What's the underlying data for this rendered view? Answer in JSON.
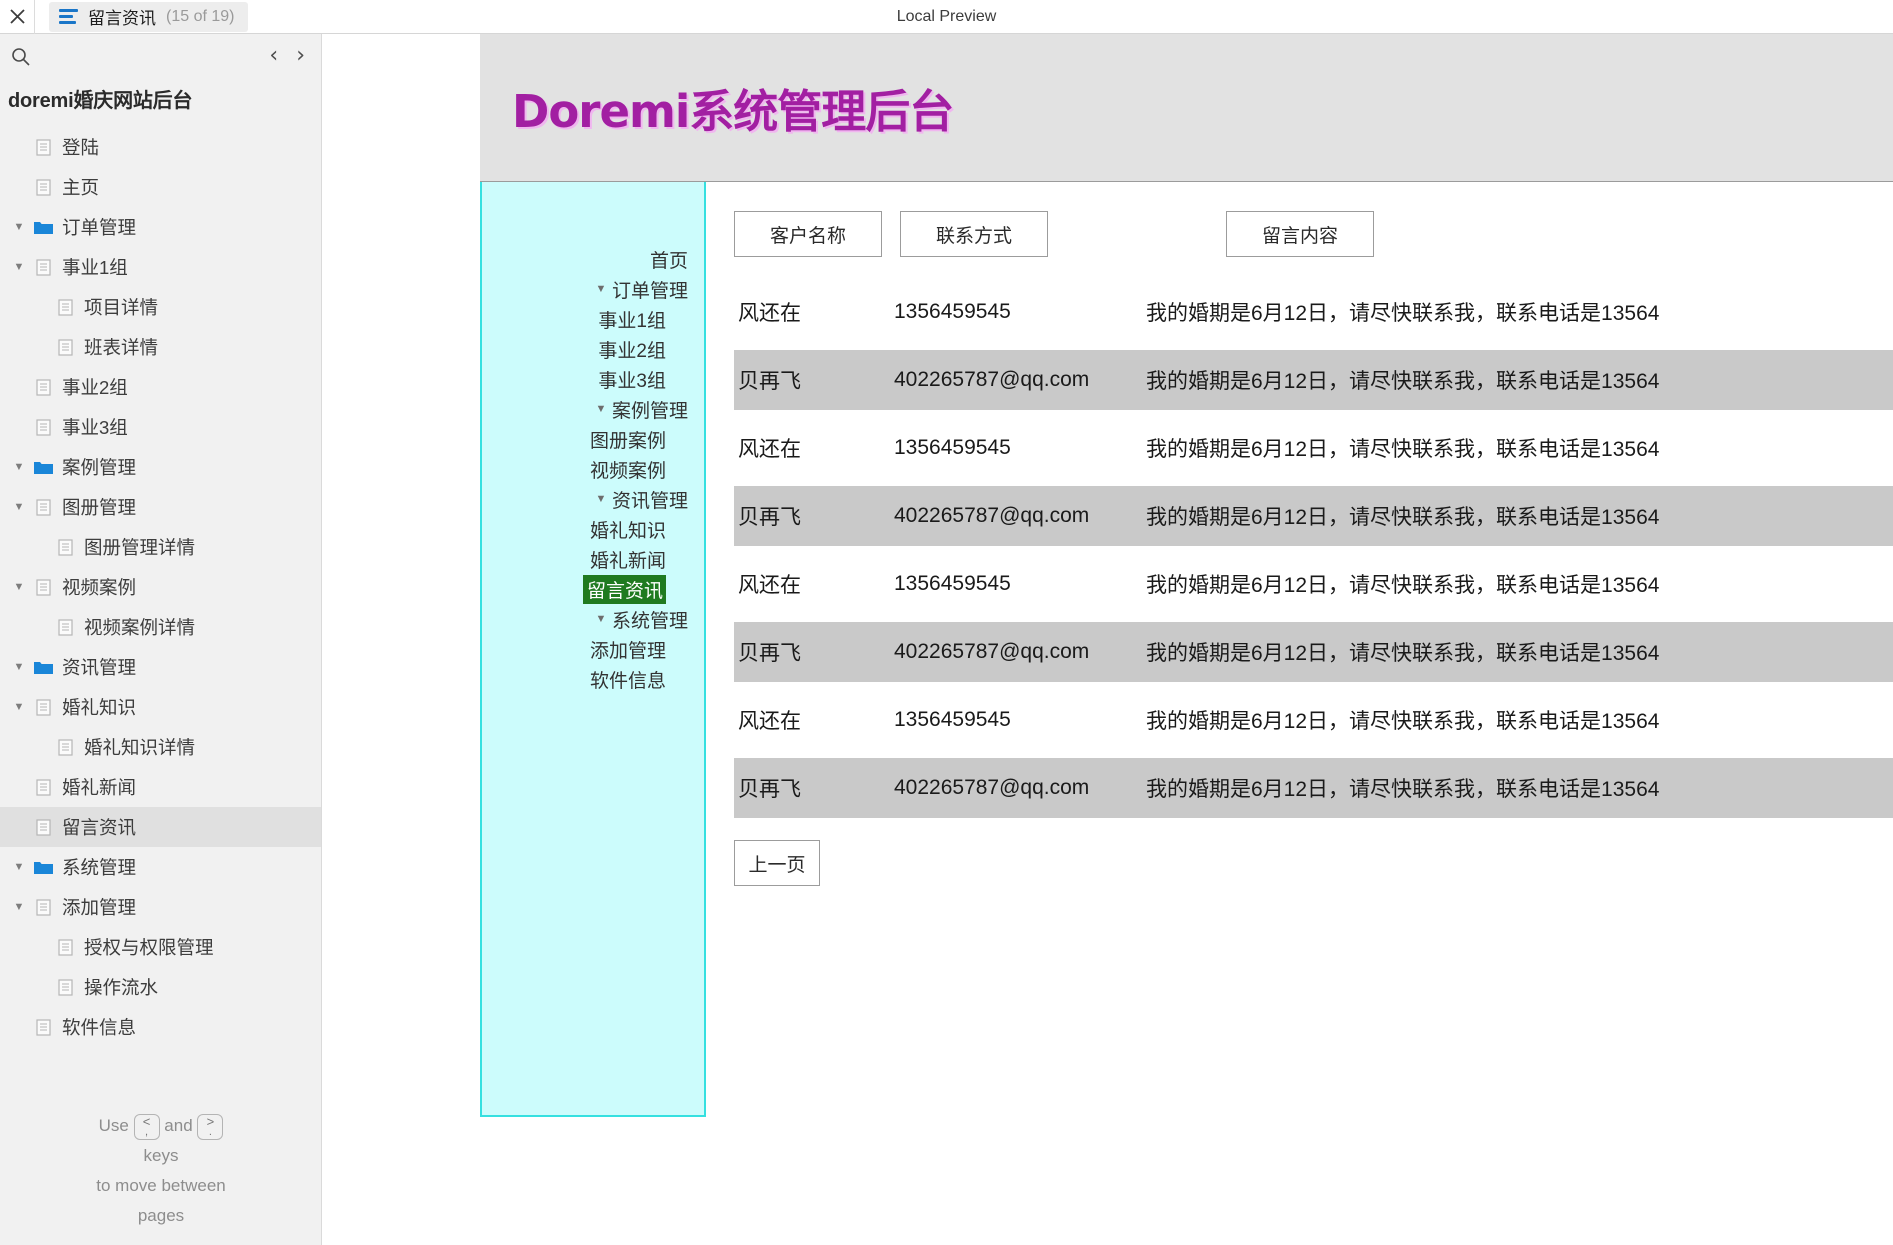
{
  "topbar": {
    "close_icon": "close-icon",
    "menu_icon": "hamburger-icon",
    "tab_title": "留言资讯",
    "tab_count": "(15 of 19)",
    "preview_label": "Local Preview"
  },
  "outline": {
    "search_icon": "search-icon",
    "prev_arrow": "‹",
    "next_arrow": "›",
    "title": "doremi婚庆网站后台",
    "items": [
      {
        "label": "登陆",
        "level": 1,
        "icon": "document-icon",
        "twisty": "",
        "selected": false
      },
      {
        "label": "主页",
        "level": 1,
        "icon": "document-icon",
        "twisty": "",
        "selected": false
      },
      {
        "label": "订单管理",
        "level": 0,
        "icon": "folder-icon",
        "twisty": "▼",
        "selected": false
      },
      {
        "label": "事业1组",
        "level": 1,
        "icon": "document-icon",
        "twisty": "▼",
        "selected": false
      },
      {
        "label": "项目详情",
        "level": 2,
        "icon": "document-icon",
        "twisty": "",
        "selected": false
      },
      {
        "label": "班表详情",
        "level": 2,
        "icon": "document-icon",
        "twisty": "",
        "selected": false
      },
      {
        "label": "事业2组",
        "level": 1,
        "icon": "document-icon",
        "twisty": "",
        "selected": false
      },
      {
        "label": "事业3组",
        "level": 1,
        "icon": "document-icon",
        "twisty": "",
        "selected": false
      },
      {
        "label": "案例管理",
        "level": 0,
        "icon": "folder-icon",
        "twisty": "▼",
        "selected": false
      },
      {
        "label": "图册管理",
        "level": 1,
        "icon": "document-icon",
        "twisty": "▼",
        "selected": false
      },
      {
        "label": "图册管理详情",
        "level": 2,
        "icon": "document-icon",
        "twisty": "",
        "selected": false
      },
      {
        "label": "视频案例",
        "level": 1,
        "icon": "document-icon",
        "twisty": "▼",
        "selected": false
      },
      {
        "label": "视频案例详情",
        "level": 2,
        "icon": "document-icon",
        "twisty": "",
        "selected": false
      },
      {
        "label": "资讯管理",
        "level": 0,
        "icon": "folder-icon",
        "twisty": "▼",
        "selected": false
      },
      {
        "label": "婚礼知识",
        "level": 1,
        "icon": "document-icon",
        "twisty": "▼",
        "selected": false
      },
      {
        "label": "婚礼知识详情",
        "level": 2,
        "icon": "document-icon",
        "twisty": "",
        "selected": false
      },
      {
        "label": "婚礼新闻",
        "level": 1,
        "icon": "document-icon",
        "twisty": "",
        "selected": false
      },
      {
        "label": "留言资讯",
        "level": 1,
        "icon": "document-icon",
        "twisty": "",
        "selected": true
      },
      {
        "label": "系统管理",
        "level": 0,
        "icon": "folder-icon",
        "twisty": "▼",
        "selected": false
      },
      {
        "label": "添加管理",
        "level": 1,
        "icon": "document-icon",
        "twisty": "▼",
        "selected": false
      },
      {
        "label": "授权与权限管理",
        "level": 2,
        "icon": "document-icon",
        "twisty": "",
        "selected": false
      },
      {
        "label": "操作流水",
        "level": 2,
        "icon": "document-icon",
        "twisty": "",
        "selected": false
      },
      {
        "label": "软件信息",
        "level": 1,
        "icon": "document-icon",
        "twisty": "",
        "selected": false
      }
    ],
    "hint": {
      "use": "Use",
      "and": "and",
      "key_prev_top": "<",
      "key_prev_bottom": ",",
      "key_next_top": ">",
      "key_next_bottom": ".",
      "line2": "keys",
      "line3": "to move between",
      "line4": "pages"
    }
  },
  "app": {
    "logo": "Doremi系统管理后台",
    "accent_color": "#a21fa2",
    "nav_bg": "#ccfcfc",
    "nav_border": "#35e0e0",
    "highlight_bg": "#1f7a20",
    "side_nav": [
      {
        "label": "首页",
        "twisty": "",
        "child": false,
        "selected": false
      },
      {
        "label": "订单管理",
        "twisty": "▼",
        "child": false,
        "selected": false
      },
      {
        "label": "事业1组",
        "twisty": "",
        "child": true,
        "selected": false
      },
      {
        "label": "事业2组",
        "twisty": "",
        "child": true,
        "selected": false
      },
      {
        "label": "事业3组",
        "twisty": "",
        "child": true,
        "selected": false
      },
      {
        "label": "案例管理",
        "twisty": "▼",
        "child": false,
        "selected": false
      },
      {
        "label": "图册案例",
        "twisty": "",
        "child": true,
        "selected": false
      },
      {
        "label": "视频案例",
        "twisty": "",
        "child": true,
        "selected": false
      },
      {
        "label": "资讯管理",
        "twisty": "▼",
        "child": false,
        "selected": false
      },
      {
        "label": "婚礼知识",
        "twisty": "",
        "child": true,
        "selected": false
      },
      {
        "label": "婚礼新闻",
        "twisty": "",
        "child": true,
        "selected": false
      },
      {
        "label": "留言资讯",
        "twisty": "",
        "child": true,
        "selected": true
      },
      {
        "label": "系统管理",
        "twisty": "▼",
        "child": false,
        "selected": false
      },
      {
        "label": "添加管理",
        "twisty": "",
        "child": true,
        "selected": false
      },
      {
        "label": "软件信息",
        "twisty": "",
        "child": true,
        "selected": false
      }
    ],
    "columns": [
      {
        "label": "客户名称"
      },
      {
        "label": "联系方式"
      },
      {
        "label": "留言内容"
      }
    ],
    "rows": [
      {
        "name": "风还在",
        "contact": "1356459545",
        "message": "我的婚期是6月12日，请尽快联系我，联系电话是13564"
      },
      {
        "name": "贝再飞",
        "contact": "402265787@qq.com",
        "message": "我的婚期是6月12日，请尽快联系我，联系电话是13564"
      },
      {
        "name": "风还在",
        "contact": "1356459545",
        "message": "我的婚期是6月12日，请尽快联系我，联系电话是13564"
      },
      {
        "name": "贝再飞",
        "contact": "402265787@qq.com",
        "message": "我的婚期是6月12日，请尽快联系我，联系电话是13564"
      },
      {
        "name": "风还在",
        "contact": "1356459545",
        "message": "我的婚期是6月12日，请尽快联系我，联系电话是13564"
      },
      {
        "name": "贝再飞",
        "contact": "402265787@qq.com",
        "message": "我的婚期是6月12日，请尽快联系我，联系电话是13564"
      },
      {
        "name": "风还在",
        "contact": "1356459545",
        "message": "我的婚期是6月12日，请尽快联系我，联系电话是13564"
      },
      {
        "name": "贝再飞",
        "contact": "402265787@qq.com",
        "message": "我的婚期是6月12日，请尽快联系我，联系电话是13564"
      }
    ],
    "prev_page_label": "上一页"
  }
}
